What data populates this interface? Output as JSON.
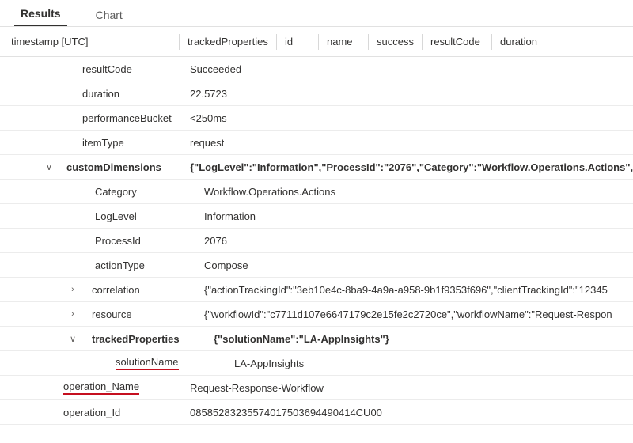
{
  "tabs": {
    "results": "Results",
    "chart": "Chart"
  },
  "columns": {
    "timestamp": "timestamp [UTC]",
    "trackedProperties": "trackedProperties",
    "id": "id",
    "name": "name",
    "success": "success",
    "resultCode": "resultCode",
    "duration": "duration"
  },
  "rows": {
    "resultCode": {
      "k": "resultCode",
      "v": "Succeeded"
    },
    "duration": {
      "k": "duration",
      "v": "22.5723"
    },
    "performanceBucket": {
      "k": "performanceBucket",
      "v": "<250ms"
    },
    "itemType": {
      "k": "itemType",
      "v": "request"
    },
    "customDimensions": {
      "k": "customDimensions",
      "v": "{\"LogLevel\":\"Information\",\"ProcessId\":\"2076\",\"Category\":\"Workflow.Operations.Actions\",\""
    },
    "Category": {
      "k": "Category",
      "v": "Workflow.Operations.Actions"
    },
    "LogLevel": {
      "k": "LogLevel",
      "v": "Information"
    },
    "ProcessId": {
      "k": "ProcessId",
      "v": "2076"
    },
    "actionType": {
      "k": "actionType",
      "v": "Compose"
    },
    "correlation": {
      "k": "correlation",
      "v": "{\"actionTrackingId\":\"3eb10e4c-8ba9-4a9a-a958-9b1f9353f696\",\"clientTrackingId\":\"12345"
    },
    "resource": {
      "k": "resource",
      "v": "{\"workflowId\":\"c7711d107e6647179c2e15fe2c2720ce\",\"workflowName\":\"Request-Respon"
    },
    "trackedProperties": {
      "k": "trackedProperties",
      "v": "{\"solutionName\":\"LA-AppInsights\"}"
    },
    "solutionName": {
      "k": "solutionName",
      "v": "LA-AppInsights"
    },
    "operation_Name": {
      "k": "operation_Name",
      "v": "Request-Response-Workflow"
    },
    "operation_Id": {
      "k": "operation_Id",
      "v": "08585283235574017503694490414CU00"
    }
  }
}
